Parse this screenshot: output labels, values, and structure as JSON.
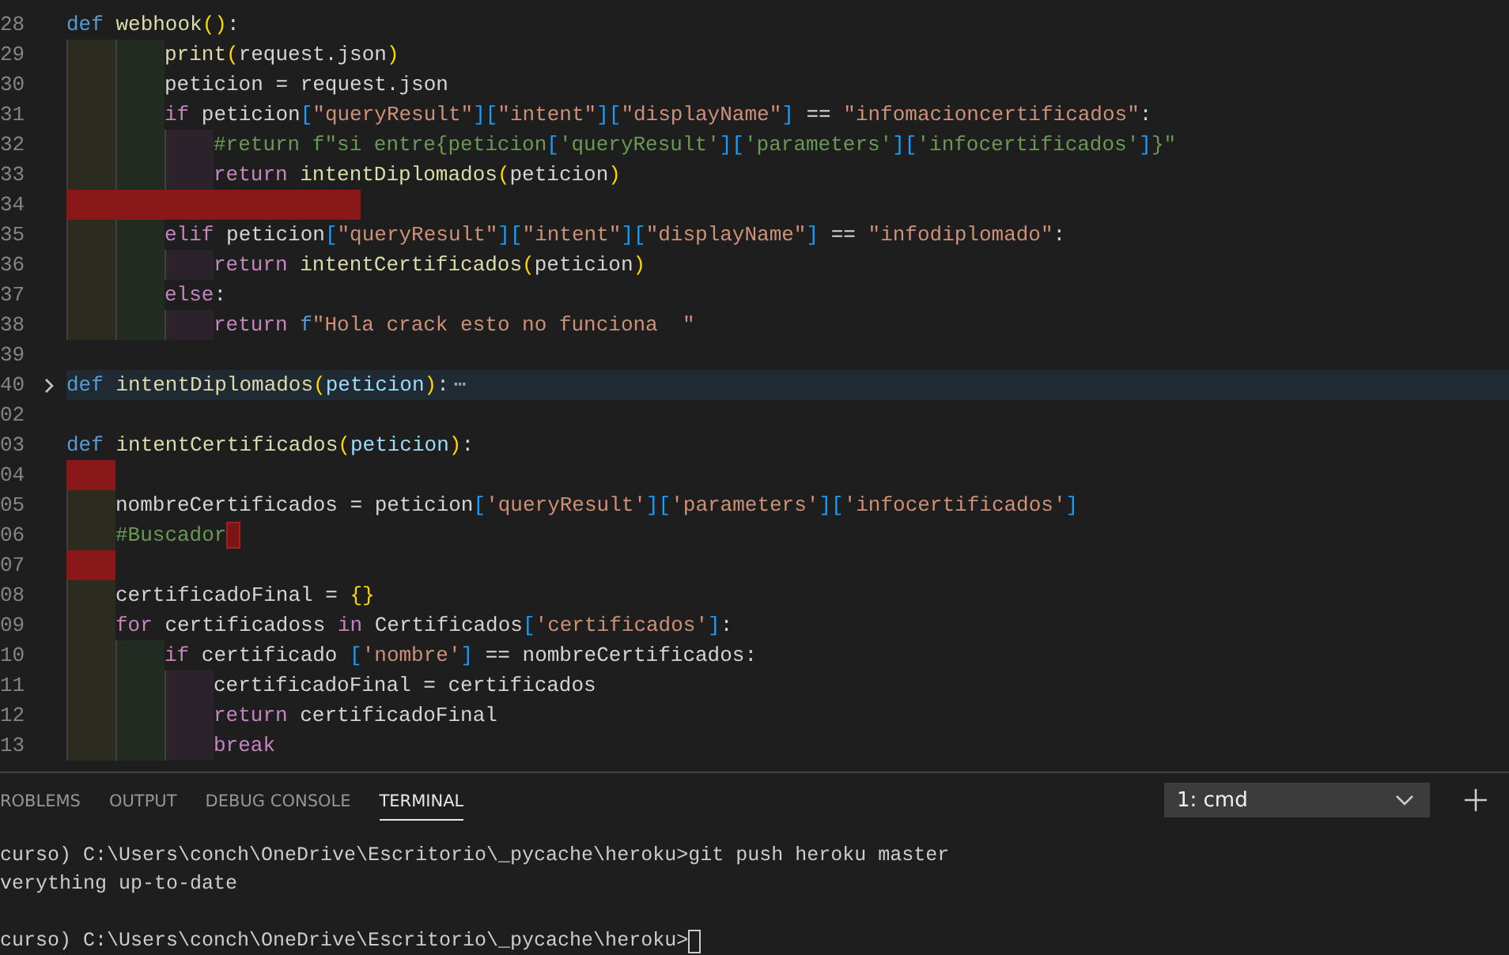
{
  "editor": {
    "lines": [
      {
        "number": "28",
        "tokens": [
          {
            "kind": "kw",
            "text": "def "
          },
          {
            "kind": "fn",
            "text": "webhook"
          },
          {
            "kind": "par",
            "text": "()"
          },
          {
            "kind": "txt",
            "text": ":"
          }
        ]
      },
      {
        "number": "29",
        "indent": [
          {
            "error": false
          },
          {
            "error": false
          }
        ],
        "tokens": [
          {
            "kind": "fn",
            "text": "print"
          },
          {
            "kind": "par",
            "text": "("
          },
          {
            "kind": "txt",
            "text": "request.json"
          },
          {
            "kind": "par",
            "text": ")"
          }
        ]
      },
      {
        "number": "30",
        "indent": [
          {
            "error": false
          },
          {
            "error": false
          }
        ],
        "tokens": [
          {
            "kind": "txt",
            "text": "peticion = request.json"
          }
        ]
      },
      {
        "number": "31",
        "indent": [
          {
            "error": false
          },
          {
            "error": false
          }
        ],
        "tokens": [
          {
            "kind": "ctl",
            "text": "if"
          },
          {
            "kind": "txt",
            "text": " peticion"
          },
          {
            "kind": "brk",
            "text": "["
          },
          {
            "kind": "str",
            "text": "\"queryResult\""
          },
          {
            "kind": "brk",
            "text": "]["
          },
          {
            "kind": "str",
            "text": "\"intent\""
          },
          {
            "kind": "brk",
            "text": "]["
          },
          {
            "kind": "str",
            "text": "\"displayName\""
          },
          {
            "kind": "brk",
            "text": "]"
          },
          {
            "kind": "txt",
            "text": " == "
          },
          {
            "kind": "str",
            "text": "\"infomacioncertificados\""
          },
          {
            "kind": "txt",
            "text": ":"
          }
        ]
      },
      {
        "number": "32",
        "indent": [
          {
            "error": false
          },
          {
            "error": false
          },
          {
            "error": false
          }
        ],
        "tokens": [
          {
            "kind": "cmt",
            "text": "#return f\"si entre{peticion"
          },
          {
            "kind": "brk",
            "text": "["
          },
          {
            "kind": "cmt",
            "text": "'queryResult'"
          },
          {
            "kind": "brk",
            "text": "]["
          },
          {
            "kind": "cmt",
            "text": "'parameters'"
          },
          {
            "kind": "brk",
            "text": "]["
          },
          {
            "kind": "cmt",
            "text": "'infocertificados'"
          },
          {
            "kind": "brk",
            "text": "]"
          },
          {
            "kind": "cmt",
            "text": "}\""
          }
        ]
      },
      {
        "number": "33",
        "indent": [
          {
            "error": false
          },
          {
            "error": false
          },
          {
            "error": false
          }
        ],
        "tokens": [
          {
            "kind": "ctl",
            "text": "return "
          },
          {
            "kind": "fn",
            "text": "intentDiplomados"
          },
          {
            "kind": "par",
            "text": "("
          },
          {
            "kind": "txt",
            "text": "peticion"
          },
          {
            "kind": "par",
            "text": ")"
          }
        ]
      },
      {
        "number": "34",
        "indent": [
          {
            "error": true
          },
          {
            "error": true
          },
          {
            "error": true
          },
          {
            "error": true
          },
          {
            "error": true
          },
          {
            "error": true
          }
        ]
      },
      {
        "number": "35",
        "indent": [
          {
            "error": false
          },
          {
            "error": false
          }
        ],
        "tokens": [
          {
            "kind": "ctl",
            "text": "elif"
          },
          {
            "kind": "txt",
            "text": " peticion"
          },
          {
            "kind": "brk",
            "text": "["
          },
          {
            "kind": "str",
            "text": "\"queryResult\""
          },
          {
            "kind": "brk",
            "text": "]["
          },
          {
            "kind": "str",
            "text": "\"intent\""
          },
          {
            "kind": "brk",
            "text": "]["
          },
          {
            "kind": "str",
            "text": "\"displayName\""
          },
          {
            "kind": "brk",
            "text": "]"
          },
          {
            "kind": "txt",
            "text": " == "
          },
          {
            "kind": "str",
            "text": "\"infodiplomado\""
          },
          {
            "kind": "txt",
            "text": ":"
          }
        ]
      },
      {
        "number": "36",
        "indent": [
          {
            "error": false
          },
          {
            "error": false
          },
          {
            "error": false
          }
        ],
        "tokens": [
          {
            "kind": "ctl",
            "text": "return "
          },
          {
            "kind": "fn",
            "text": "intentCertificados"
          },
          {
            "kind": "par",
            "text": "("
          },
          {
            "kind": "txt",
            "text": "peticion"
          },
          {
            "kind": "par",
            "text": ")"
          }
        ]
      },
      {
        "number": "37",
        "indent": [
          {
            "error": false
          },
          {
            "error": false
          }
        ],
        "tokens": [
          {
            "kind": "ctl",
            "text": "else"
          },
          {
            "kind": "txt",
            "text": ":"
          }
        ]
      },
      {
        "number": "38",
        "indent": [
          {
            "error": false
          },
          {
            "error": false
          },
          {
            "error": false
          }
        ],
        "tokens": [
          {
            "kind": "ctl",
            "text": "return "
          },
          {
            "kind": "kw",
            "text": "f"
          },
          {
            "kind": "str",
            "text": "\"Hola crack esto no funciona  \""
          }
        ]
      },
      {
        "number": "39"
      },
      {
        "number": "40",
        "current": true,
        "folded": true,
        "tokens": [
          {
            "kind": "kw",
            "text": "def "
          },
          {
            "kind": "fn",
            "text": "intentDiplomados"
          },
          {
            "kind": "par",
            "text": "("
          },
          {
            "kind": "param",
            "text": "peticion"
          },
          {
            "kind": "par",
            "text": ")"
          },
          {
            "kind": "txt",
            "text": ":"
          },
          {
            "kind": "fold",
            "text": "⋯"
          }
        ]
      },
      {
        "number": "02"
      },
      {
        "number": "03",
        "tokens": [
          {
            "kind": "kw",
            "text": "def "
          },
          {
            "kind": "fn",
            "text": "intentCertificados"
          },
          {
            "kind": "par",
            "text": "("
          },
          {
            "kind": "param",
            "text": "peticion"
          },
          {
            "kind": "par",
            "text": ")"
          },
          {
            "kind": "txt",
            "text": ":"
          }
        ]
      },
      {
        "number": "04",
        "indent": [
          {
            "error": true
          }
        ]
      },
      {
        "number": "05",
        "indent": [
          {
            "error": false
          }
        ],
        "tokens": [
          {
            "kind": "txt",
            "text": "nombreCertificados = peticion"
          },
          {
            "kind": "brk",
            "text": "["
          },
          {
            "kind": "str",
            "text": "'queryResult'"
          },
          {
            "kind": "brk",
            "text": "]["
          },
          {
            "kind": "str",
            "text": "'parameters'"
          },
          {
            "kind": "brk",
            "text": "]["
          },
          {
            "kind": "str",
            "text": "'infocertificados'"
          },
          {
            "kind": "brk",
            "text": "]"
          }
        ]
      },
      {
        "number": "06",
        "indent": [
          {
            "error": false
          }
        ],
        "trailing_error": true,
        "tokens": [
          {
            "kind": "cmt",
            "text": "#Buscador"
          }
        ]
      },
      {
        "number": "07",
        "indent": [
          {
            "error": true
          }
        ]
      },
      {
        "number": "08",
        "indent": [
          {
            "error": false
          }
        ],
        "tokens": [
          {
            "kind": "txt",
            "text": "certificadoFinal = "
          },
          {
            "kind": "par",
            "text": "{}"
          }
        ]
      },
      {
        "number": "09",
        "indent": [
          {
            "error": false
          }
        ],
        "tokens": [
          {
            "kind": "ctl",
            "text": "for"
          },
          {
            "kind": "txt",
            "text": " certificadoss "
          },
          {
            "kind": "ctl",
            "text": "in"
          },
          {
            "kind": "txt",
            "text": " Certificados"
          },
          {
            "kind": "brk",
            "text": "["
          },
          {
            "kind": "str",
            "text": "'certificados'"
          },
          {
            "kind": "brk",
            "text": "]"
          },
          {
            "kind": "txt",
            "text": ":"
          }
        ]
      },
      {
        "number": "10",
        "indent": [
          {
            "error": false
          },
          {
            "error": false
          }
        ],
        "tokens": [
          {
            "kind": "ctl",
            "text": "if"
          },
          {
            "kind": "txt",
            "text": " certificado "
          },
          {
            "kind": "brk",
            "text": "["
          },
          {
            "kind": "str",
            "text": "'nombre'"
          },
          {
            "kind": "brk",
            "text": "]"
          },
          {
            "kind": "txt",
            "text": " == nombreCertificados:"
          }
        ]
      },
      {
        "number": "11",
        "indent": [
          {
            "error": false
          },
          {
            "error": false
          },
          {
            "error": false
          }
        ],
        "tokens": [
          {
            "kind": "txt",
            "text": "certificadoFinal = certificados"
          }
        ]
      },
      {
        "number": "12",
        "indent": [
          {
            "error": false
          },
          {
            "error": false
          },
          {
            "error": false
          }
        ],
        "tokens": [
          {
            "kind": "ctl",
            "text": "return"
          },
          {
            "kind": "txt",
            "text": " certificadoFinal"
          }
        ]
      },
      {
        "number": "13",
        "indent": [
          {
            "error": false
          },
          {
            "error": false
          },
          {
            "error": false
          }
        ],
        "tokens": [
          {
            "kind": "ctl",
            "text": "break"
          }
        ]
      }
    ]
  },
  "panel": {
    "tabs": [
      {
        "label": "ROBLEMS",
        "selected": false
      },
      {
        "label": "OUTPUT",
        "selected": false
      },
      {
        "label": "DEBUG CONSOLE",
        "selected": false
      },
      {
        "label": "TERMINAL",
        "selected": true
      }
    ],
    "terminal_select": {
      "value": "1: cmd"
    },
    "terminal": [
      {
        "lines": [
          "curso) C:\\Users\\conch\\OneDrive\\Escritorio\\_pycache\\heroku>git push heroku master",
          "verything up-to-date"
        ],
        "cursor": false
      },
      {
        "lines": [
          "curso) C:\\Users\\conch\\OneDrive\\Escritorio\\_pycache\\heroku>"
        ],
        "cursor": true
      }
    ]
  }
}
